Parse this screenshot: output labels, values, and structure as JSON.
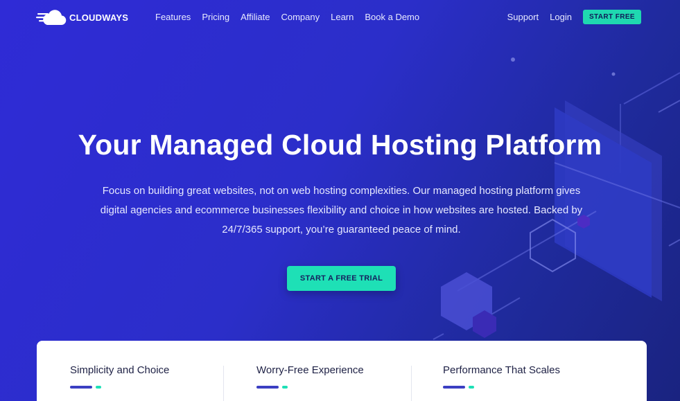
{
  "brand": {
    "name": "CLOUDWAYS"
  },
  "nav": {
    "items": [
      "Features",
      "Pricing",
      "Affiliate",
      "Company",
      "Learn",
      "Book a Demo"
    ],
    "support_label": "Support",
    "login_label": "Login",
    "start_free_label": "START FREE"
  },
  "hero": {
    "title": "Your Managed Cloud Hosting Platform",
    "subtitle": "Focus on building great websites, not on web hosting complexities. Our managed hosting platform gives digital agencies and ecommerce businesses flexibility and choice in how websites are hosted. Backed by 24/7/365 support, you’re guaranteed peace of mind.",
    "cta_label": "START A FREE TRIAL"
  },
  "features": [
    {
      "title": "Simplicity and Choice"
    },
    {
      "title": "Worry-Free Experience"
    },
    {
      "title": "Performance That Scales"
    }
  ],
  "colors": {
    "accent": "#1ee0b6",
    "background": "#2f2bd6",
    "bar": "#3b3fc2"
  }
}
